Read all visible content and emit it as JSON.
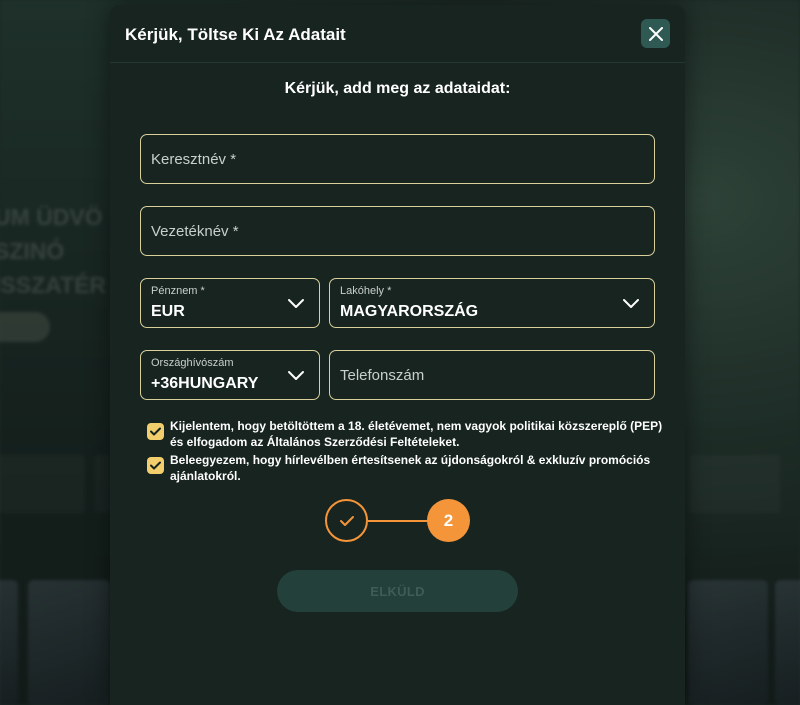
{
  "background": {
    "hero_lines": [
      "UM ÜDVÖ",
      "SZINÓ",
      "ISSZATÉR"
    ]
  },
  "modal": {
    "title": "Kérjük, Töltse Ki Az Adatait",
    "close_icon": "close-icon",
    "subtitle": "Kérjük, add meg az adataidat:"
  },
  "form": {
    "first_name": {
      "placeholder": "Keresztnév *"
    },
    "last_name": {
      "placeholder": "Vezetéknév *"
    },
    "currency": {
      "label": "Pénznem *",
      "value": "EUR"
    },
    "residence": {
      "label": "Lakóhely *",
      "value": "MAGYARORSZÁG"
    },
    "country_code": {
      "label": "Országhívószám",
      "value": "+36HUNGARY"
    },
    "phone": {
      "placeholder": "Telefonszám"
    },
    "consents": [
      {
        "checked": true,
        "text": "Kijelentem, hogy betöltöttem a 18. életévemet, nem vagyok politikai közszereplő (PEP) és elfogadom az Általános Szerződési Feltételeket."
      },
      {
        "checked": true,
        "text": "Beleegyezem, hogy hírlevélben értesítsenek az újdonságokról & exkluzív promóciós ajánlatokról."
      }
    ],
    "stepper": {
      "completed_step_icon": "check-icon",
      "current_step": "2"
    },
    "submit_label": "ELKÜLD"
  },
  "colors": {
    "accent_gold": "#d9cf9a",
    "checkbox": "#f2cf6c",
    "step_orange": "#f5953a",
    "modal_bg": "#172420",
    "button_disabled": "#24403b"
  }
}
